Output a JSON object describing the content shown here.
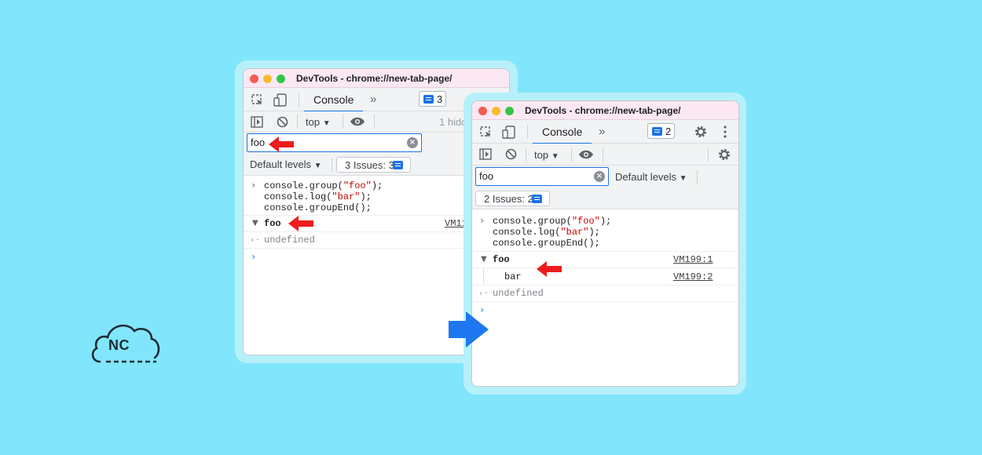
{
  "brand": {
    "logo_text": "NC"
  },
  "colors": {
    "background": "#81e6fb",
    "arrow_red": "#ee1c1c",
    "arrow_blue": "#1e77f0",
    "accent": "#1a73e8"
  },
  "left_window": {
    "title": "DevTools - chrome://new-tab-page/",
    "tab": "Console",
    "more_tabs": "»",
    "messages_badge": "3",
    "context": "top",
    "hidden_text": "1 hidde",
    "filter_value": "foo",
    "levels": "Default levels",
    "issues_button": "3 Issues:",
    "issues_count": "3",
    "code": [
      "console.group(",
      "\"foo\"",
      ");",
      "console.log(",
      "\"bar\"",
      ");",
      "console.groupEnd();"
    ],
    "group_label": "foo",
    "group_link": "VM111",
    "result": "undefined"
  },
  "right_window": {
    "title": "DevTools - chrome://new-tab-page/",
    "tab": "Console",
    "more_tabs": "»",
    "messages_badge": "2",
    "context": "top",
    "filter_value": "foo",
    "levels": "Default levels",
    "issues_button": "2 Issues:",
    "issues_count": "2",
    "code": [
      "console.group(",
      "\"foo\"",
      ");",
      "console.log(",
      "\"bar\"",
      ");",
      "console.groupEnd();"
    ],
    "group_label": "foo",
    "group_link": "VM199:1",
    "child_label": "bar",
    "child_link": "VM199:2",
    "result": "undefined"
  }
}
